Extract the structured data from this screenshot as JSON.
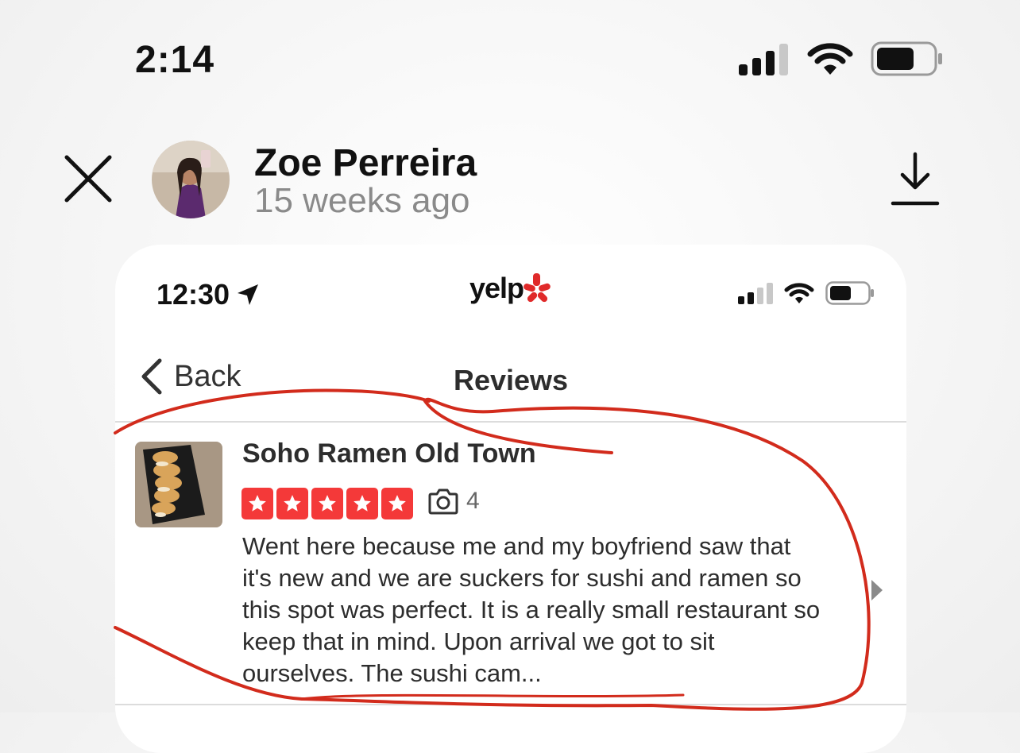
{
  "os_status": {
    "time": "2:14"
  },
  "story": {
    "author": "Zoe Perreira",
    "posted": "15 weeks ago"
  },
  "screenshot": {
    "status": {
      "time": "12:30",
      "app_logo": "yelp"
    },
    "nav": {
      "back_label": "Back",
      "title": "Reviews"
    },
    "review": {
      "business": "Soho Ramen Old Town",
      "rating": 5,
      "photo_count": "4",
      "text": "Went here because me and my boyfriend saw that it's new and we are suckers for sushi and ramen so this spot was perfect. It is a really small restaurant so keep that in mind. Upon arrival we got to sit ourselves. The sushi cam..."
    }
  },
  "colors": {
    "star": "#f43939",
    "annotation": "#d22b1c"
  }
}
